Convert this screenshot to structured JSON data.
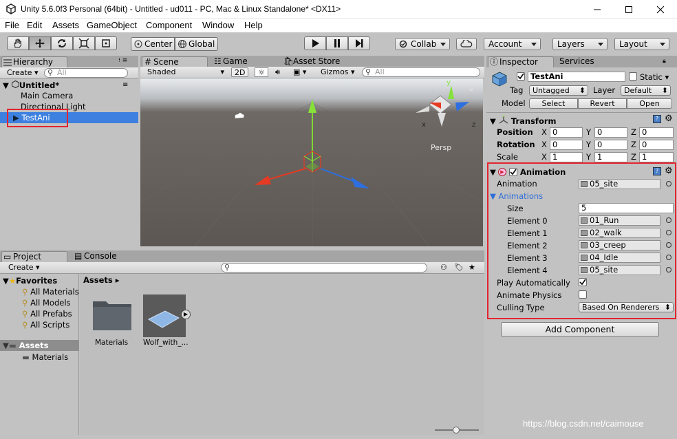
{
  "window": {
    "title": "Unity 5.6.0f3 Personal (64bit) - Untitled - ud011 - PC, Mac & Linux Standalone* <DX11>"
  },
  "menu": [
    "File",
    "Edit",
    "Assets",
    "GameObject",
    "Component",
    "Window",
    "Help"
  ],
  "toolbar": {
    "pivot": "Center",
    "space": "Global",
    "collab": "Collab",
    "account": "Account",
    "layers": "Layers",
    "layout": "Layout"
  },
  "hierarchy": {
    "tab": "Hierarchy",
    "create": "Create",
    "search_placeholder": "All",
    "scene": "Untitled*",
    "items": [
      "Main Camera",
      "Directional Light",
      "TestAni"
    ]
  },
  "scene": {
    "tabs": [
      "Scene",
      "Game",
      "Asset Store"
    ],
    "shading": "Shaded",
    "mode2d": "2D",
    "gizmos": "Gizmos",
    "search_placeholder": "All",
    "persp": "Persp",
    "gizmo_y": "y",
    "gizmo_x": "x",
    "gizmo_z": "z"
  },
  "project": {
    "tabs": [
      "Project",
      "Console"
    ],
    "create": "Create",
    "favorites": "Favorites",
    "favorite_items": [
      "All Materials",
      "All Models",
      "All Prefabs",
      "All Scripts"
    ],
    "assets": "Assets",
    "asset_folders": [
      "Materials"
    ],
    "breadcrumb": "Assets",
    "grid_items": [
      "Materials",
      "Wolf_with_..."
    ]
  },
  "inspector": {
    "tabs": [
      "Inspector",
      "Services"
    ],
    "object_name": "TestAni",
    "static": "Static",
    "tag_label": "Tag",
    "tag": "Untagged",
    "layer_label": "Layer",
    "layer": "Default",
    "model_label": "Model",
    "model_buttons": [
      "Select",
      "Revert",
      "Open"
    ],
    "transform": {
      "title": "Transform",
      "rows": [
        {
          "label": "Position",
          "x": "0",
          "y": "0",
          "z": "0"
        },
        {
          "label": "Rotation",
          "x": "0",
          "y": "0",
          "z": "0"
        },
        {
          "label": "Scale",
          "x": "1",
          "y": "1",
          "z": "1"
        }
      ],
      "axis": [
        "X",
        "Y",
        "Z"
      ]
    },
    "animation": {
      "title": "Animation",
      "animation_label": "Animation",
      "animation_value": "05_site",
      "animations_label": "Animations",
      "size_label": "Size",
      "size": "5",
      "elements": [
        {
          "label": "Element 0",
          "value": "01_Run"
        },
        {
          "label": "Element 1",
          "value": "02_walk"
        },
        {
          "label": "Element 2",
          "value": "03_creep"
        },
        {
          "label": "Element 3",
          "value": "04_Idle"
        },
        {
          "label": "Element 4",
          "value": "05_site"
        }
      ],
      "play_auto_label": "Play Automatically",
      "physics_label": "Animate Physics",
      "culling_label": "Culling Type",
      "culling": "Based On Renderers"
    },
    "add_component": "Add Component"
  },
  "watermark": "https://blog.csdn.net/caimouse",
  "colors": {
    "selection": "#3d80df",
    "highlight": "#e4242f",
    "link": "#2f6ed8"
  }
}
